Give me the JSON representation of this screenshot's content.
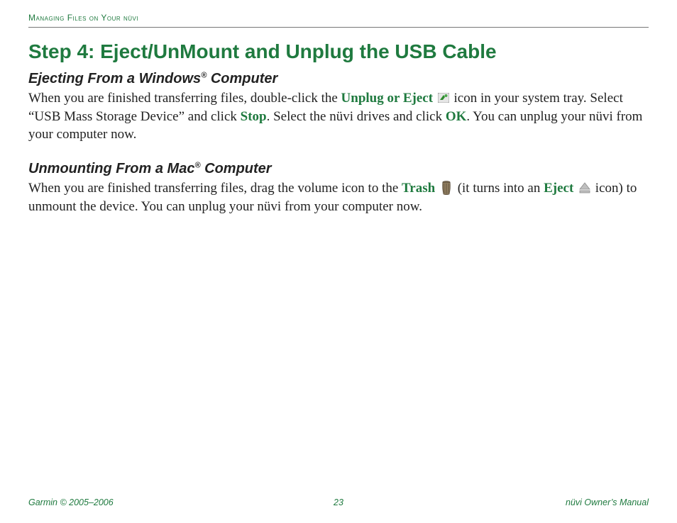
{
  "running_head": "Managing Files on Your nüvi",
  "title": "Step 4: Eject/UnMount and Unplug the USB Cable",
  "section_windows": {
    "heading_pre": "Ejecting From a Windows",
    "heading_sup": "®",
    "heading_post": " Computer",
    "p1a": "When you are finished transferring files, double-click the ",
    "kw_unplug": "Unplug or Eject",
    "p1b": " icon in your system tray. Select “USB Mass Storage Device” and click ",
    "kw_stop": "Stop",
    "p1c": ". Select the nüvi drives and click ",
    "kw_ok": "OK",
    "p1d": ". You can unplug your nüvi from your computer now."
  },
  "section_mac": {
    "heading_pre": "Unmounting From a Mac",
    "heading_sup": "®",
    "heading_post": " Computer",
    "p1a": "When you are finished transferring files, drag the volume icon to the ",
    "kw_trash": "Trash",
    "p1b": " (it turns into an ",
    "kw_eject": "Eject",
    "p1c": " icon) to unmount the device. You can unplug your nüvi from your computer now."
  },
  "footer": {
    "left": "Garmin © 2005–2006",
    "center": "23",
    "right": "nüvi Owner’s Manual"
  }
}
